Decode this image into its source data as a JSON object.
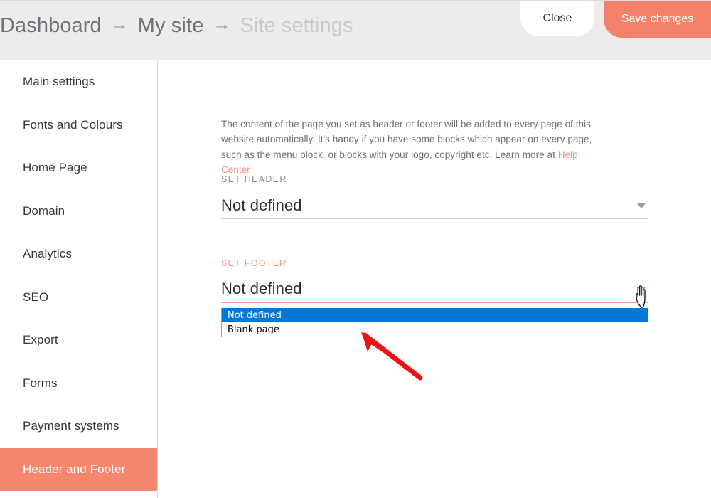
{
  "header": {
    "breadcrumb": [
      {
        "label": "Dashboard",
        "current": false
      },
      {
        "label": "My site",
        "current": false
      },
      {
        "label": "Site settings",
        "current": true
      }
    ],
    "separator": "→",
    "close_label": "Close",
    "save_label": "Save changes",
    "accent_color": "#f4826a",
    "background_color": "#ececec"
  },
  "sidebar": {
    "items": [
      {
        "label": "Main settings",
        "active": false
      },
      {
        "label": "Fonts and Colours",
        "active": false
      },
      {
        "label": "Home Page",
        "active": false
      },
      {
        "label": "Domain",
        "active": false
      },
      {
        "label": "Analytics",
        "active": false
      },
      {
        "label": "SEO",
        "active": false
      },
      {
        "label": "Export",
        "active": false
      },
      {
        "label": "Forms",
        "active": false
      },
      {
        "label": "Payment systems",
        "active": false
      },
      {
        "label": "Header and Footer",
        "active": true
      }
    ],
    "active_background": "#f4876e"
  },
  "main": {
    "intro_text_part1": "The content of the page you set as header or footer will be added to every page of this website automatically. It's handy if you have some blocks which appear on every page, such as the menu block, or blocks with your logo, copyright etc. Learn more at ",
    "intro_link": "Help Center",
    "header_field": {
      "label": "SET HEADER",
      "value": "Not defined",
      "caret_color": "#9b9b9b"
    },
    "footer_field": {
      "label": "SET FOOTER",
      "value": "Not defined",
      "caret_color": "#f4826a",
      "open": true,
      "options": [
        {
          "label": "Not defined",
          "selected": true
        },
        {
          "label": "Blank page",
          "selected": false
        }
      ],
      "selected_background": "#0078d7"
    }
  },
  "annotations": {
    "arrow_color": "#ee1111",
    "cursor": "pointer-hand-cursor"
  }
}
